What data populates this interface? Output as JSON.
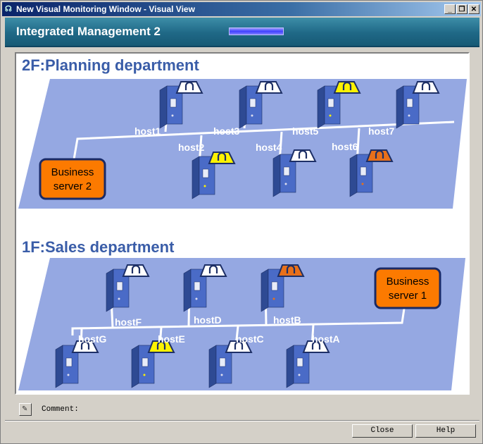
{
  "window": {
    "title": "New Visual Monitoring Window - Visual View",
    "minimize_glyph": "_",
    "restore_glyph": "❐",
    "close_glyph": "✕"
  },
  "banner": {
    "title": "Integrated Management 2",
    "progress": 1.0
  },
  "floors": [
    {
      "title": "2F:Planning department",
      "server": {
        "line1": "Business",
        "line2": "server 2"
      },
      "hosts": [
        {
          "name": "host1",
          "status": "normal"
        },
        {
          "name": "host2",
          "status": "warning"
        },
        {
          "name": "host3",
          "status": "normal"
        },
        {
          "name": "host4",
          "status": "normal"
        },
        {
          "name": "host5",
          "status": "warning"
        },
        {
          "name": "host6",
          "status": "error"
        },
        {
          "name": "host7",
          "status": "normal"
        }
      ]
    },
    {
      "title": "1F:Sales department",
      "server": {
        "line1": "Business",
        "line2": "server 1"
      },
      "hosts": [
        {
          "name": "hostF",
          "status": "normal"
        },
        {
          "name": "hostD",
          "status": "normal"
        },
        {
          "name": "hostB",
          "status": "error"
        },
        {
          "name": "hostG",
          "status": "normal"
        },
        {
          "name": "hostE",
          "status": "warning"
        },
        {
          "name": "hostC",
          "status": "normal"
        },
        {
          "name": "hostA",
          "status": "normal"
        }
      ]
    }
  ],
  "colors": {
    "floor_panel": "#95a8e2",
    "network_line": "#ffffff",
    "server_box": "#fc7a00",
    "status_normal": "#ffffff",
    "status_warning": "#fdf200",
    "status_error": "#e8701a",
    "dept_title": "#3a5da8"
  },
  "footer": {
    "comment_label": "Comment:",
    "close_label": "Close",
    "help_label": "Help"
  }
}
